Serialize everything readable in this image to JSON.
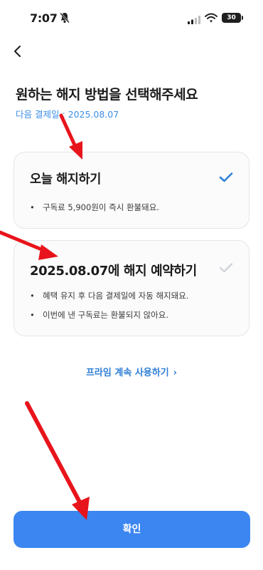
{
  "status_bar": {
    "time": "7:07",
    "battery": "30",
    "icons": [
      "bell-off-icon",
      "signal-icon",
      "wifi-icon",
      "battery-icon"
    ]
  },
  "header": {
    "back_icon": "chevron-left-icon"
  },
  "title": "원하는 해지 방법을 선택해주세요",
  "next_payment": "다음 결제일 : 2025.08.07",
  "options": [
    {
      "title": "오늘 해지하기",
      "selected": true,
      "bullets": [
        "구독료 5,900원이 즉시 환불돼요."
      ]
    },
    {
      "title": "2025.08.07에 해지 예약하기",
      "selected": false,
      "bullets": [
        "혜택 유지 후 다음 결제일에 자동 해지돼요.",
        "이번에 낸 구독료는 환불되지 않아요."
      ]
    }
  ],
  "continue_link": "프라임 계속 사용하기",
  "confirm_label": "확인",
  "colors": {
    "accent": "#3b86f0",
    "link": "#2f7fd6",
    "check_selected": "#2f7fd6",
    "check_unselected": "#cfd3d8",
    "annotation_arrow": "#e8141c"
  }
}
